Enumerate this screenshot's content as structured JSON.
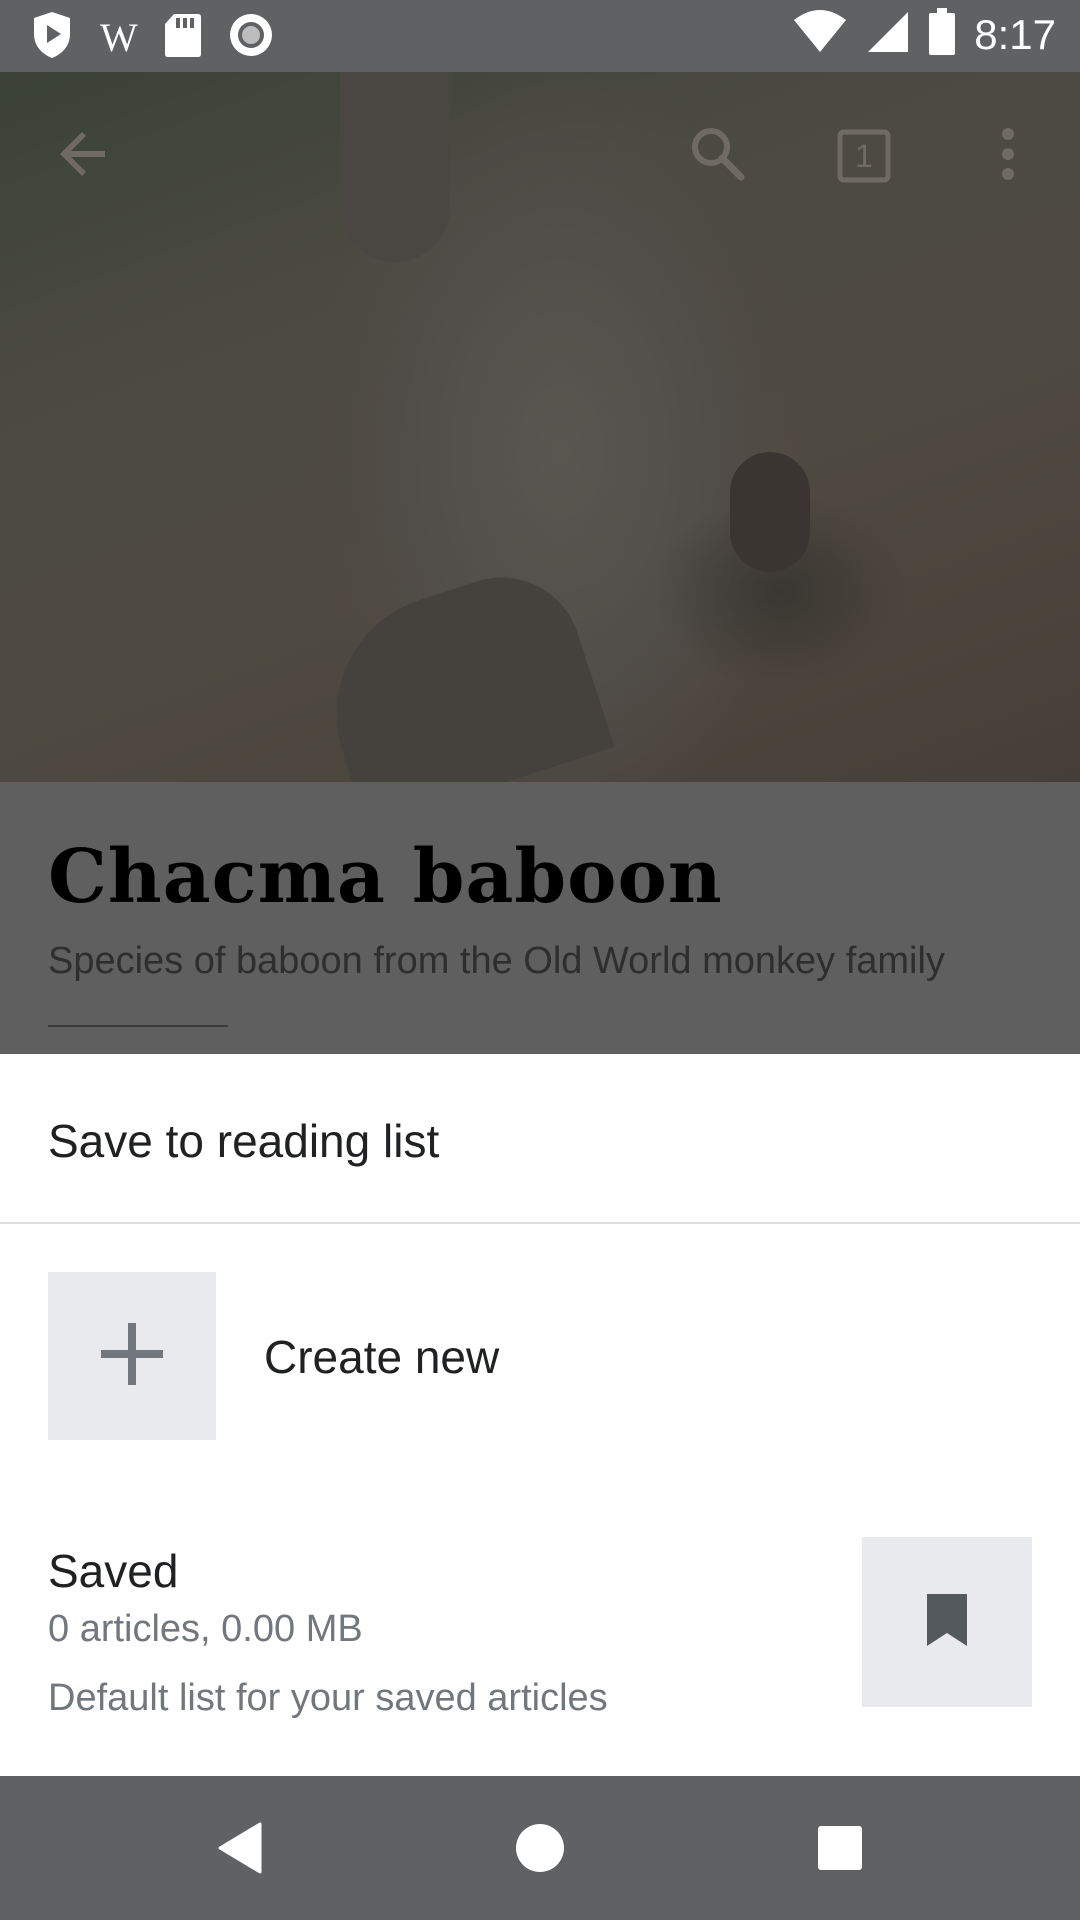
{
  "status_bar": {
    "time": "8:17",
    "left_icons": [
      "play-protect-icon",
      "wikipedia-w-icon",
      "sd-card-icon",
      "record-icon"
    ],
    "right_icons": [
      "wifi-icon",
      "cell-signal-icon",
      "battery-icon"
    ],
    "wikipedia_glyph": "W"
  },
  "toolbar": {
    "icons": [
      "back-arrow-icon",
      "search-icon",
      "tabs-icon",
      "overflow-menu-icon"
    ],
    "tab_count": "1"
  },
  "article": {
    "title": "Chacma baboon",
    "description": "Species of baboon from the Old World monkey family"
  },
  "sheet": {
    "header": "Save to reading list",
    "create_new_label": "Create new",
    "lists": [
      {
        "name": "Saved",
        "meta": "0 articles, 0.00 MB",
        "description": "Default list for your saved articles"
      }
    ]
  },
  "nav_bar": {
    "icons": [
      "back-triangle-icon",
      "home-circle-icon",
      "recents-square-icon"
    ]
  }
}
